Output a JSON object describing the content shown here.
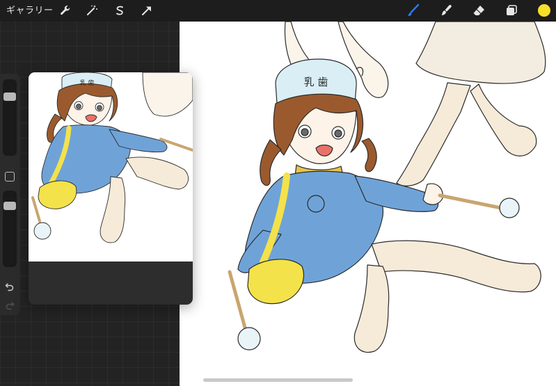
{
  "topbar": {
    "gallery_label": "ギャラリー",
    "tools_left": [
      {
        "name": "actions",
        "icon": "wrench-icon"
      },
      {
        "name": "adjustments",
        "icon": "magic-wand-icon"
      },
      {
        "name": "selection",
        "icon": "selection-s-icon"
      },
      {
        "name": "transform",
        "icon": "arrow-cursor-icon"
      }
    ],
    "tools_right": [
      {
        "name": "brush",
        "icon": "brush-icon",
        "active": true
      },
      {
        "name": "smudge",
        "icon": "smudge-icon"
      },
      {
        "name": "eraser",
        "icon": "eraser-icon"
      },
      {
        "name": "layers",
        "icon": "layers-icon"
      },
      {
        "name": "color",
        "icon": "color-swatch",
        "value": "#f5e02a"
      }
    ]
  },
  "sidebar": {
    "brush_size_level": 0.82,
    "brush_opacity_level": 0.85
  },
  "reference_window": {
    "content": "reference-image",
    "cap_text": "乳 歯"
  },
  "canvas": {
    "cap_text": "乳 歯"
  },
  "colors": {
    "accent_blue": "#2f7bf0",
    "active_color": "#f5e02a",
    "topbar_bg": "#1d1d1d",
    "workspace_bg": "#232323",
    "uniform_blue": "#6fa3d8",
    "bag_yellow": "#f4e24a",
    "hair_brown": "#9b5a2e",
    "skin": "#f3e3cf"
  }
}
